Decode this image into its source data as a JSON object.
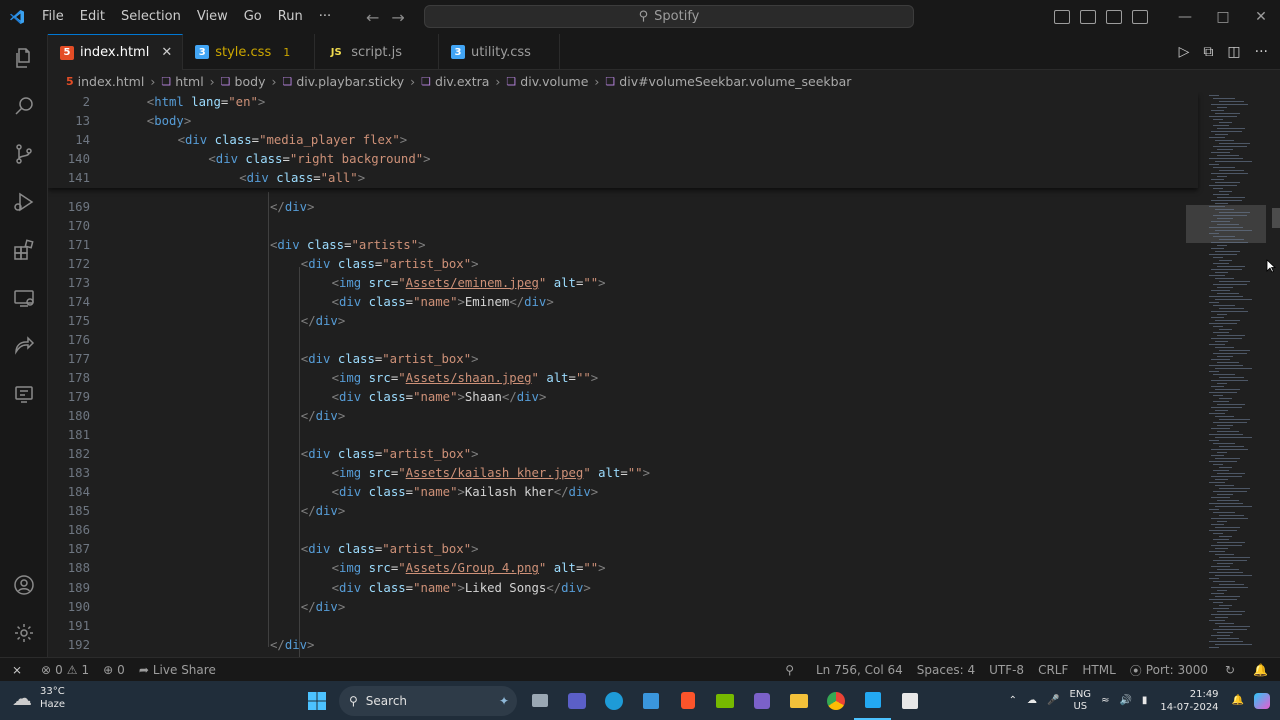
{
  "menu": [
    "File",
    "Edit",
    "Selection",
    "View",
    "Go",
    "Run",
    "···"
  ],
  "search_title": "Spotify",
  "tabs": [
    {
      "label": "index.html",
      "type": "html",
      "extra": "✕",
      "active": true
    },
    {
      "label": "style.css",
      "type": "css",
      "extra": "1",
      "active": false
    },
    {
      "label": "script.js",
      "type": "js",
      "extra": "",
      "active": false
    },
    {
      "label": "utility.css",
      "type": "css",
      "extra": "",
      "active": false
    }
  ],
  "breadcrumb": [
    "index.html",
    "html",
    "body",
    "div.playbar.sticky",
    "div.extra",
    "div.volume",
    "div#volumeSeekbar.volume_seekbar"
  ],
  "sticky_lines": [
    {
      "n": "2",
      "indent": 1,
      "code": [
        [
          "t",
          "<"
        ],
        [
          "tg",
          "html"
        ],
        [
          "tx",
          " "
        ],
        [
          "at",
          "lang"
        ],
        [
          "tx",
          "="
        ],
        [
          "sv",
          "\"en\""
        ],
        [
          "t",
          ">"
        ]
      ]
    },
    {
      "n": "13",
      "indent": 1,
      "code": [
        [
          "t",
          "<"
        ],
        [
          "tg",
          "body"
        ],
        [
          "t",
          ">"
        ]
      ]
    },
    {
      "n": "14",
      "indent": 2,
      "code": [
        [
          "t",
          "<"
        ],
        [
          "tg",
          "div"
        ],
        [
          "tx",
          " "
        ],
        [
          "at",
          "class"
        ],
        [
          "tx",
          "="
        ],
        [
          "sv",
          "\"media_player flex\""
        ],
        [
          "t",
          ">"
        ]
      ]
    },
    {
      "n": "140",
      "indent": 3,
      "code": [
        [
          "t",
          "<"
        ],
        [
          "tg",
          "div"
        ],
        [
          "tx",
          " "
        ],
        [
          "at",
          "class"
        ],
        [
          "tx",
          "="
        ],
        [
          "sv",
          "\"right background\""
        ],
        [
          "t",
          ">"
        ]
      ]
    },
    {
      "n": "141",
      "indent": 4,
      "code": [
        [
          "t",
          "<"
        ],
        [
          "tg",
          "div"
        ],
        [
          "tx",
          " "
        ],
        [
          "at",
          "class"
        ],
        [
          "tx",
          "="
        ],
        [
          "sv",
          "\"all\""
        ],
        [
          "t",
          ">"
        ]
      ]
    }
  ],
  "code_lines": [
    {
      "n": "169",
      "indent": 5,
      "code": [
        [
          "t",
          "</"
        ],
        [
          "tg",
          "div"
        ],
        [
          "t",
          ">"
        ]
      ]
    },
    {
      "n": "170",
      "indent": 0,
      "code": []
    },
    {
      "n": "171",
      "indent": 5,
      "code": [
        [
          "t",
          "<"
        ],
        [
          "tg",
          "div"
        ],
        [
          "tx",
          " "
        ],
        [
          "at",
          "class"
        ],
        [
          "tx",
          "="
        ],
        [
          "sv",
          "\"artists\""
        ],
        [
          "t",
          ">"
        ]
      ]
    },
    {
      "n": "172",
      "indent": 6,
      "code": [
        [
          "t",
          "<"
        ],
        [
          "tg",
          "div"
        ],
        [
          "tx",
          " "
        ],
        [
          "at",
          "class"
        ],
        [
          "tx",
          "="
        ],
        [
          "sv",
          "\"artist_box\""
        ],
        [
          "t",
          ">"
        ]
      ]
    },
    {
      "n": "173",
      "indent": 7,
      "code": [
        [
          "t",
          "<"
        ],
        [
          "tg",
          "img"
        ],
        [
          "tx",
          " "
        ],
        [
          "at",
          "src"
        ],
        [
          "tx",
          "="
        ],
        [
          "sv",
          "\""
        ],
        [
          "svu",
          "Assets/eminem.jpeg"
        ],
        [
          "sv",
          "\""
        ],
        [
          "tx",
          " "
        ],
        [
          "at",
          "alt"
        ],
        [
          "tx",
          "="
        ],
        [
          "sv",
          "\"\""
        ],
        [
          "t",
          ">"
        ]
      ]
    },
    {
      "n": "174",
      "indent": 7,
      "code": [
        [
          "t",
          "<"
        ],
        [
          "tg",
          "div"
        ],
        [
          "tx",
          " "
        ],
        [
          "at",
          "class"
        ],
        [
          "tx",
          "="
        ],
        [
          "sv",
          "\"name\""
        ],
        [
          "t",
          ">"
        ],
        [
          "tx",
          "Eminem"
        ],
        [
          "t",
          "</"
        ],
        [
          "tg",
          "div"
        ],
        [
          "t",
          ">"
        ]
      ]
    },
    {
      "n": "175",
      "indent": 6,
      "code": [
        [
          "t",
          "</"
        ],
        [
          "tg",
          "div"
        ],
        [
          "t",
          ">"
        ]
      ]
    },
    {
      "n": "176",
      "indent": 0,
      "code": []
    },
    {
      "n": "177",
      "indent": 6,
      "code": [
        [
          "t",
          "<"
        ],
        [
          "tg",
          "div"
        ],
        [
          "tx",
          " "
        ],
        [
          "at",
          "class"
        ],
        [
          "tx",
          "="
        ],
        [
          "sv",
          "\"artist_box\""
        ],
        [
          "t",
          ">"
        ]
      ]
    },
    {
      "n": "178",
      "indent": 7,
      "code": [
        [
          "t",
          "<"
        ],
        [
          "tg",
          "img"
        ],
        [
          "tx",
          " "
        ],
        [
          "at",
          "src"
        ],
        [
          "tx",
          "="
        ],
        [
          "sv",
          "\""
        ],
        [
          "svu",
          "Assets/shaan.jpeg"
        ],
        [
          "sv",
          "\""
        ],
        [
          "tx",
          " "
        ],
        [
          "at",
          "alt"
        ],
        [
          "tx",
          "="
        ],
        [
          "sv",
          "\"\""
        ],
        [
          "t",
          ">"
        ]
      ]
    },
    {
      "n": "179",
      "indent": 7,
      "code": [
        [
          "t",
          "<"
        ],
        [
          "tg",
          "div"
        ],
        [
          "tx",
          " "
        ],
        [
          "at",
          "class"
        ],
        [
          "tx",
          "="
        ],
        [
          "sv",
          "\"name\""
        ],
        [
          "t",
          ">"
        ],
        [
          "tx",
          "Shaan"
        ],
        [
          "t",
          "</"
        ],
        [
          "tg",
          "div"
        ],
        [
          "t",
          ">"
        ]
      ]
    },
    {
      "n": "180",
      "indent": 6,
      "code": [
        [
          "t",
          "</"
        ],
        [
          "tg",
          "div"
        ],
        [
          "t",
          ">"
        ]
      ]
    },
    {
      "n": "181",
      "indent": 0,
      "code": []
    },
    {
      "n": "182",
      "indent": 6,
      "code": [
        [
          "t",
          "<"
        ],
        [
          "tg",
          "div"
        ],
        [
          "tx",
          " "
        ],
        [
          "at",
          "class"
        ],
        [
          "tx",
          "="
        ],
        [
          "sv",
          "\"artist_box\""
        ],
        [
          "t",
          ">"
        ]
      ]
    },
    {
      "n": "183",
      "indent": 7,
      "code": [
        [
          "t",
          "<"
        ],
        [
          "tg",
          "img"
        ],
        [
          "tx",
          " "
        ],
        [
          "at",
          "src"
        ],
        [
          "tx",
          "="
        ],
        [
          "sv",
          "\""
        ],
        [
          "svu",
          "Assets/kailash kher.jpeg"
        ],
        [
          "sv",
          "\""
        ],
        [
          "tx",
          " "
        ],
        [
          "at",
          "alt"
        ],
        [
          "tx",
          "="
        ],
        [
          "sv",
          "\"\""
        ],
        [
          "t",
          ">"
        ]
      ]
    },
    {
      "n": "184",
      "indent": 7,
      "code": [
        [
          "t",
          "<"
        ],
        [
          "tg",
          "div"
        ],
        [
          "tx",
          " "
        ],
        [
          "at",
          "class"
        ],
        [
          "tx",
          "="
        ],
        [
          "sv",
          "\"name\""
        ],
        [
          "t",
          ">"
        ],
        [
          "tx",
          "Kailash kher"
        ],
        [
          "t",
          "</"
        ],
        [
          "tg",
          "div"
        ],
        [
          "t",
          ">"
        ]
      ]
    },
    {
      "n": "185",
      "indent": 6,
      "code": [
        [
          "t",
          "</"
        ],
        [
          "tg",
          "div"
        ],
        [
          "t",
          ">"
        ]
      ]
    },
    {
      "n": "186",
      "indent": 0,
      "code": []
    },
    {
      "n": "187",
      "indent": 6,
      "code": [
        [
          "t",
          "<"
        ],
        [
          "tg",
          "div"
        ],
        [
          "tx",
          " "
        ],
        [
          "at",
          "class"
        ],
        [
          "tx",
          "="
        ],
        [
          "sv",
          "\"artist_box\""
        ],
        [
          "t",
          ">"
        ]
      ]
    },
    {
      "n": "188",
      "indent": 7,
      "code": [
        [
          "t",
          "<"
        ],
        [
          "tg",
          "img"
        ],
        [
          "tx",
          " "
        ],
        [
          "at",
          "src"
        ],
        [
          "tx",
          "="
        ],
        [
          "sv",
          "\""
        ],
        [
          "svu",
          "Assets/Group 4.png"
        ],
        [
          "sv",
          "\""
        ],
        [
          "tx",
          " "
        ],
        [
          "at",
          "alt"
        ],
        [
          "tx",
          "="
        ],
        [
          "sv",
          "\"\""
        ],
        [
          "t",
          ">"
        ]
      ]
    },
    {
      "n": "189",
      "indent": 7,
      "code": [
        [
          "t",
          "<"
        ],
        [
          "tg",
          "div"
        ],
        [
          "tx",
          " "
        ],
        [
          "at",
          "class"
        ],
        [
          "tx",
          "="
        ],
        [
          "sv",
          "\"name\""
        ],
        [
          "t",
          ">"
        ],
        [
          "tx",
          "Liked Songs"
        ],
        [
          "t",
          "</"
        ],
        [
          "tg",
          "div"
        ],
        [
          "t",
          ">"
        ]
      ]
    },
    {
      "n": "190",
      "indent": 6,
      "code": [
        [
          "t",
          "</"
        ],
        [
          "tg",
          "div"
        ],
        [
          "t",
          ">"
        ]
      ]
    },
    {
      "n": "191",
      "indent": 0,
      "code": []
    },
    {
      "n": "192",
      "indent": 5,
      "code": [
        [
          "t",
          "</"
        ],
        [
          "tg",
          "div"
        ],
        [
          "t",
          ">"
        ]
      ]
    }
  ],
  "status": {
    "errors": "0",
    "warnings": "1",
    "ports": "0",
    "live_share": "Live Share",
    "position": "Ln 756, Col 64",
    "spaces": "Spaces: 4",
    "encoding": "UTF-8",
    "eol": "CRLF",
    "language": "HTML",
    "port": "Port: 3000"
  },
  "taskbar": {
    "temp": "33°C",
    "weather": "Haze",
    "search": "Search",
    "lang_top": "ENG",
    "lang_bottom": "US",
    "time": "21:49",
    "date": "14-07-2024"
  },
  "colors": {
    "accent": "#0078d4",
    "editor_bg": "#1f1f1f",
    "chrome_bg": "#181818",
    "taskbar_bg": "#202d3a"
  }
}
